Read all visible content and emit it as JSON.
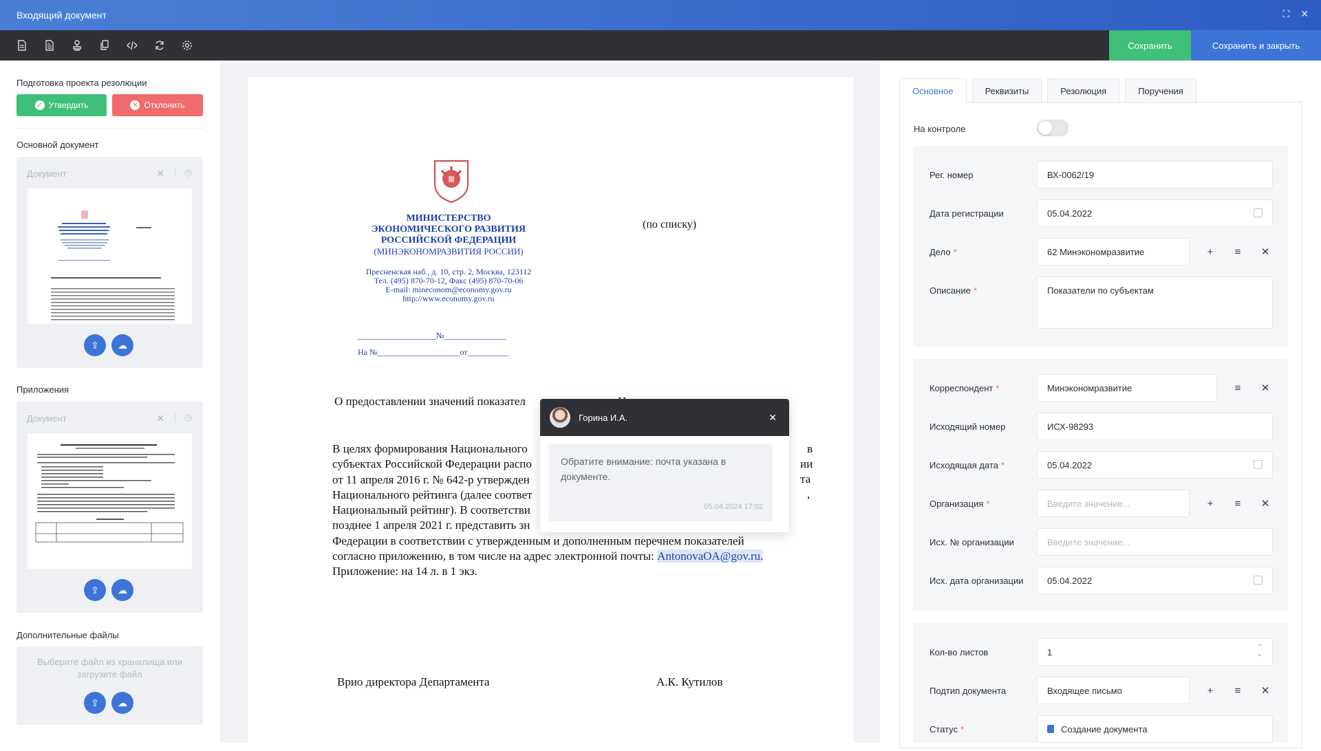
{
  "window": {
    "title": "Входящий документ",
    "maximize": "⛶",
    "close": "✕"
  },
  "toolbar": {
    "tools": [
      "file-icon",
      "file-alt-icon",
      "stamp-icon",
      "copy-icon",
      "code-icon",
      "refresh-icon",
      "gear-icon"
    ],
    "save_label": "Сохранить",
    "save_close_label": "Сохранить и закрыть"
  },
  "left": {
    "resolution_title": "Подготовка проекта резолюции",
    "approve_label": "Утвердить",
    "reject_label": "Отклонить",
    "main_doc_title": "Основной документ",
    "doc_placeholder": "Документ",
    "attachments_title": "Приложения",
    "attach_placeholder": "Документ",
    "extra_title": "Дополнительные файлы",
    "extra_hint_1": "Выберите файл из хранилища или",
    "extra_hint_2": "загрузите файл"
  },
  "document": {
    "ministry_1": "МИНИСТЕРСТВО",
    "ministry_2": "ЭКОНОМИЧЕСКОГО РАЗВИТИЯ",
    "ministry_3": "РОССИЙСКОЙ ФЕДЕРАЦИИ",
    "ministry_4": "(МИНЭКОНОМРАЗВИТИЯ РОССИИ)",
    "addr_1": "Пресненская наб., д. 10, стр. 2, Москва, 123112",
    "addr_2": "Тел. (495) 870-70-12, Факс (495) 870-70-06",
    "addr_3": "E-mail: mineconom@economy.gov.ru",
    "addr_4": "http://www.economy.gov.ru",
    "to_list": "(по списку)",
    "reg_line_1": "___________________№_______________",
    "reg_line_2": "На №____________________от__________",
    "subject": "О предоставлении значений показател",
    "subject_tail": "Н",
    "body_lines": [
      "В целях формирования Национального",
      "субъектах Российской Федерации распо",
      "от 11 апреля 2016 г. № 642-р утвержден",
      "Национального рейтинга (далее соответ",
      "Национальный рейтинг). В соответстви",
      "позднее 1 апреля 2021 г. представить зн",
      "Федерации в соответствии с утвержденным и дополненным перечнем показателей",
      "согласно приложению, в том числе на адрес электронной почты: ",
      "Приложение: на 14 л. в 1 экз."
    ],
    "body_right_fragments": [
      "в",
      "ии",
      "та",
      ","
    ],
    "email": "AntonovaOA@gov.ru.",
    "signer_title": "Врио директора  Департамента",
    "signer_name": "А.К. Кутилов"
  },
  "popup": {
    "author": "Горина И.А.",
    "message": "Обратите внимание: почта указана в документе.",
    "time": "05.04.2024 17:02"
  },
  "tabs": [
    "Основное",
    "Реквизиты",
    "Резолюция",
    "Поручения"
  ],
  "form": {
    "on_control_label": "На контроле",
    "reg_number_label": "Рег. номер",
    "reg_number": "ВХ-0062/19",
    "reg_date_label": "Дата регистрации",
    "reg_date": "05.04.2022",
    "case_label": "Дело",
    "case": "62 Минэкономразвитие",
    "desc_label": "Описание",
    "desc": "Показатели по субъектам",
    "corr_label": "Корреспондент",
    "corr": "Минэкономразвитие",
    "out_num_label": "Исходящий номер",
    "out_num": "ИСХ-98293",
    "out_date_label": "Исходящая дата",
    "out_date": "05.04.2022",
    "org_label": "Организация",
    "org_placeholder": "Введите значение...",
    "org_num_label": "Исх. № организации",
    "org_num_placeholder": "Введите значение...",
    "org_date_label": "Исх. дата организации",
    "org_date": "05.04.2022",
    "sheets_label": "Кол-во листов",
    "sheets": "1",
    "subtype_label": "Подтип документа",
    "subtype": "Входящее письмо",
    "status_label": "Статус",
    "status": "Создание документа"
  }
}
